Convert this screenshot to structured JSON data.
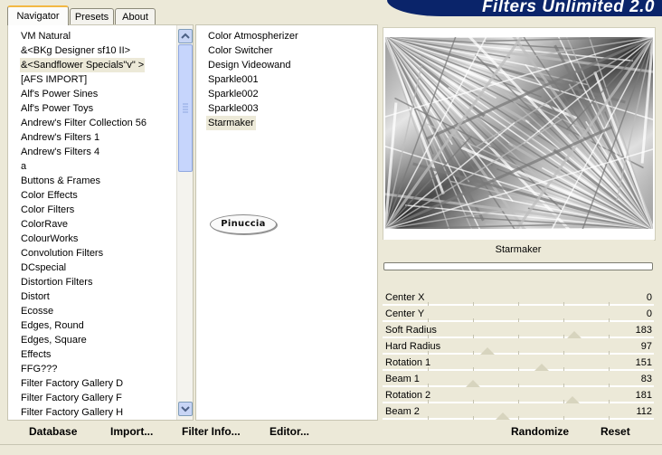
{
  "tabs": [
    {
      "label": "Navigator",
      "active": true
    },
    {
      "label": "Presets",
      "active": false
    },
    {
      "label": "About",
      "active": false
    }
  ],
  "banner": {
    "title": "Filters Unlimited 2.0"
  },
  "categories": [
    "VM Natural",
    "&<BKg Designer sf10 II>",
    "&<Sandflower Specials\"v\" >",
    "[AFS IMPORT]",
    "Alf's Power Sines",
    "Alf's Power Toys",
    "Andrew's Filter Collection 56",
    "Andrew's Filters 1",
    "Andrew's Filters 4",
    "a",
    "Buttons & Frames",
    "Color Effects",
    "Color Filters",
    "ColorRave",
    "ColourWorks",
    "Convolution Filters",
    "DCspecial",
    "Distortion Filters",
    "Distort",
    "Ecosse",
    "Edges, Round",
    "Edges, Square",
    "Effects",
    "FFG???",
    "Filter Factory Gallery D",
    "Filter Factory Gallery F",
    "Filter Factory Gallery H"
  ],
  "selected_category_index": 2,
  "filters": [
    "Color Atmospherizer",
    "Color Switcher",
    "Design Videowand",
    "Sparkle001",
    "Sparkle002",
    "Sparkle003",
    "Starmaker"
  ],
  "selected_filter_index": 6,
  "logo_text": "Pinuccia",
  "preview": {
    "filter_name": "Starmaker",
    "progress": 0
  },
  "controls": [
    {
      "label": "Center X",
      "value": "0",
      "max": 255
    },
    {
      "label": "Center Y",
      "value": "0",
      "max": 255
    },
    {
      "label": "Soft Radius",
      "value": "183",
      "max": 255
    },
    {
      "label": "Hard Radius",
      "value": "97",
      "max": 255
    },
    {
      "label": "Rotation 1",
      "value": "151",
      "max": 255
    },
    {
      "label": "Beam 1",
      "value": "83",
      "max": 255
    },
    {
      "label": "Rotation 2",
      "value": "181",
      "max": 255
    },
    {
      "label": "Beam 2",
      "value": "112",
      "max": 255
    }
  ],
  "buttons": {
    "database": "Database",
    "import": "Import...",
    "filter_info": "Filter Info...",
    "editor": "Editor...",
    "randomize": "Randomize",
    "reset": "Reset"
  },
  "colors": {
    "dialog_bg": "#ece9d8",
    "banner_bg": "#0a246a",
    "active_tab_accent": "#f2b843",
    "scrollbar_blue": "#c6d5fc"
  },
  "icons": {
    "scroll_up": "chevron-up-icon",
    "scroll_down": "chevron-down-icon"
  }
}
